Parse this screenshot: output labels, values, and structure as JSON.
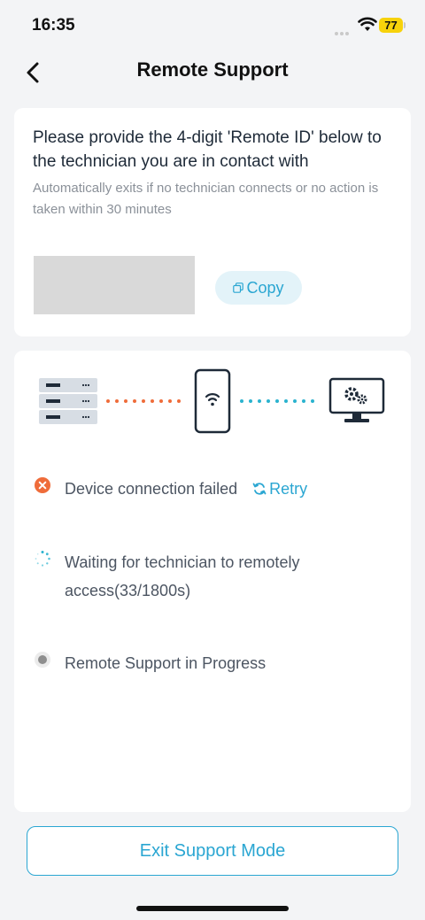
{
  "status_bar": {
    "time": "16:35",
    "battery": "77"
  },
  "header": {
    "title": "Remote Support"
  },
  "id_card": {
    "instruction": "Please provide the 4-digit 'Remote ID' below to the technician you are in contact with",
    "hint": "Automatically exits if no technician connects or no action is taken within 30 minutes",
    "copy_label": "Copy"
  },
  "status_card": {
    "device_status": {
      "text": "Device connection failed",
      "state": "failed"
    },
    "retry_label": "Retry",
    "waiting_status": {
      "text": "Waiting for technician to remotely access(33/1800s)",
      "state": "loading",
      "elapsed": 33,
      "total": 1800
    },
    "progress_status": {
      "text": "Remote Support in Progress",
      "state": "pending"
    }
  },
  "footer": {
    "exit_label": "Exit Support Mode"
  },
  "colors": {
    "accent": "#2aa6d2",
    "error": "#ef6c3a",
    "pending": "#8e8e8e"
  }
}
